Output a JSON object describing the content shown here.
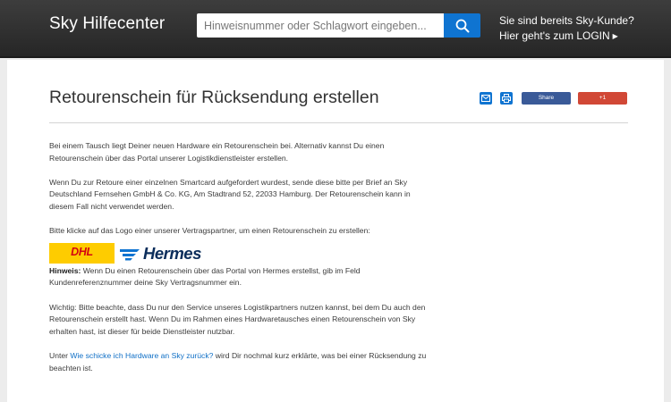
{
  "header": {
    "brand": "Sky Hilfecenter",
    "search": {
      "placeholder": "Hinweisnummer oder Schlagwort eingeben..."
    },
    "login_line1": "Sie sind bereits Sky-Kunde?",
    "login_line2": "Hier geht's zum LOGIN",
    "search_button_color": "#0f74d1"
  },
  "article": {
    "title": "Retourenschein für Rücksendung erstellen",
    "share": {
      "facebook": "Share",
      "google": "+1"
    },
    "paragraphs": {
      "p1": "Bei einem Tausch liegt Deiner neuen Hardware ein Retourenschein bei. Alternativ kannst Du einen Retourenschein über das Portal unserer Logistikdienstleister erstellen.",
      "p2": "Wenn Du zur Retoure einer einzelnen Smartcard aufgefordert wurdest, sende diese bitte per Brief an Sky Deutschland Fernsehen GmbH & Co. KG, Am Stadtrand 52, 22033 Hamburg. Der Retourenschein kann in diesem Fall nicht verwendet werden.",
      "p3": "Bitte klicke auf das Logo einer unserer Vertragspartner, um einen Retourenschein zu erstellen:",
      "logos": {
        "dhl": "DHL",
        "hermes": "Hermes"
      },
      "hint_label": "Hinweis:",
      "hint_text": " Wenn Du einen Retourenschein über das Portal von Hermes erstellst, gib im Feld Kundenreferenznummer deine Sky Vertragsnummer ein.",
      "p5": "Wichtig: Bitte beachte, dass Du nur den Service unseres Logistikpartners nutzen kannst, bei dem Du auch den Retourenschein erstellt hast. Wenn Du im Rahmen eines Hardwaretausches einen Retourenschein von Sky erhalten hast, ist dieser für beide Dienstleister nutzbar.",
      "p6_pre": "Unter ",
      "p6_link": "Wie schicke ich Hardware an Sky zurück?",
      "p6_post": " wird Dir nochmal kurz erklärte, was bei einer Rücksendung zu beachten ist."
    }
  }
}
